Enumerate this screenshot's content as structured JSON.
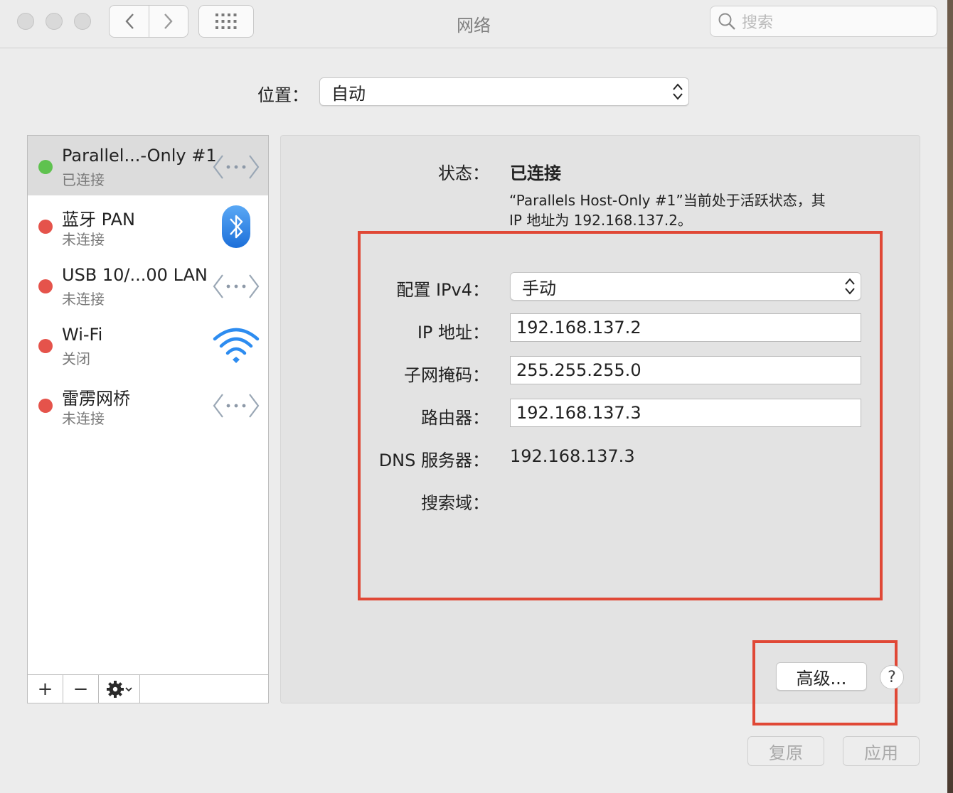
{
  "window": {
    "title": "网络",
    "search_placeholder": "搜索"
  },
  "location": {
    "label": "位置：",
    "value": "自动"
  },
  "services": [
    {
      "name": "Parallel...-Only #1",
      "status": "已连接",
      "status_color": "#5fc24f",
      "icon": "ethernet-icon",
      "selected": true
    },
    {
      "name": "蓝牙 PAN",
      "status": "未连接",
      "status_color": "#e5534b",
      "icon": "bluetooth-icon",
      "selected": false
    },
    {
      "name": "USB 10/...00 LAN",
      "status": "未连接",
      "status_color": "#e5534b",
      "icon": "ethernet-icon",
      "selected": false
    },
    {
      "name": "Wi-Fi",
      "status": "关闭",
      "status_color": "#e5534b",
      "icon": "wifi-icon",
      "selected": false
    },
    {
      "name": "雷雳网桥",
      "status": "未连接",
      "status_color": "#e5534b",
      "icon": "ethernet-icon",
      "selected": false
    }
  ],
  "sidebar_bar": {
    "add": "+",
    "remove": "−"
  },
  "detail": {
    "status_label": "状态：",
    "status_value": "已连接",
    "description_line1": "“Parallels Host-Only #1”当前处于活跃状态，其",
    "description_line2": "IP 地址为 192.168.137.2。",
    "ipv4_label": "配置 IPv4：",
    "ipv4_value": "手动",
    "ip_label": "IP 地址：",
    "ip_value": "192.168.137.2",
    "subnet_label": "子网掩码：",
    "subnet_value": "255.255.255.0",
    "router_label": "路由器：",
    "router_value": "192.168.137.3",
    "dns_label": "DNS 服务器：",
    "dns_value": "192.168.137.3",
    "search_domain_label": "搜索域："
  },
  "buttons": {
    "advanced": "高级...",
    "help": "?",
    "revert": "复原",
    "apply": "应用"
  },
  "colors": {
    "highlight_box": "#e04836",
    "connected": "#5fc24f",
    "disconnected": "#e5534b"
  }
}
